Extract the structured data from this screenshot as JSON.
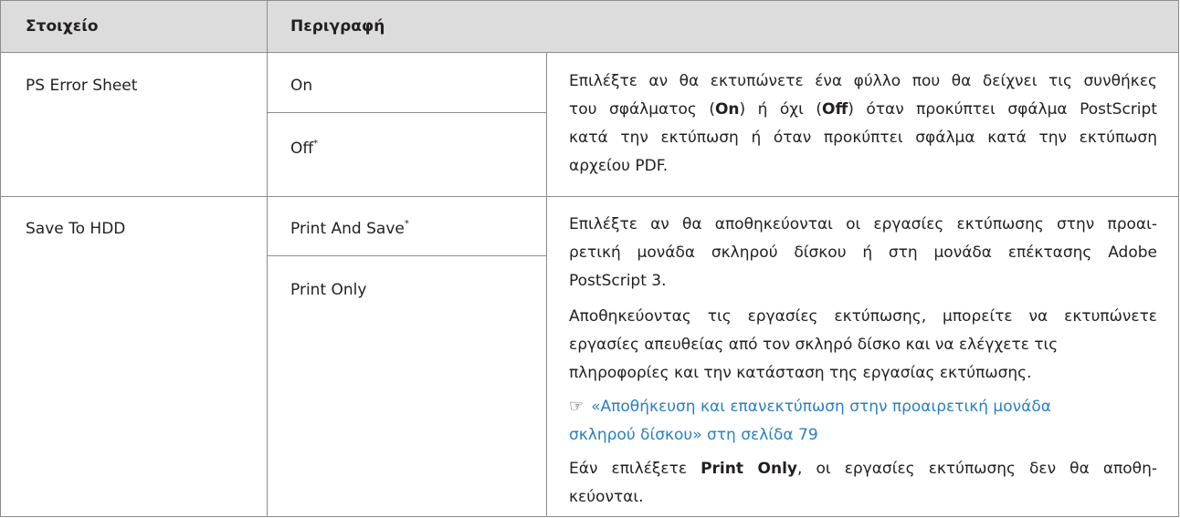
{
  "table": {
    "headers": {
      "item": "Στοιχείο",
      "description": "Περιγραφή"
    },
    "rows": [
      {
        "item": "PS Error Sheet",
        "options": [
          {
            "label": "On",
            "marker": ""
          },
          {
            "label": "Off",
            "marker": "*"
          }
        ],
        "description": {
          "lines": [
            {
              "a": "Επιλέξτε αν θα εκτυπώνετε ένα φύλλο που θα δείχνει τις συνθήκες"
            },
            {
              "a": "του σφάλματος (",
              "b": "On",
              "c": ") ή όχι (",
              "d": "Off",
              "e": ") όταν προκύπτει σφάλμα PostScript"
            },
            {
              "a": "κατά την εκτύπωση ή όταν προκύπτει σφάλμα κατά την εκτύπωση"
            },
            {
              "a": "αρχείου PDF."
            }
          ]
        }
      },
      {
        "item": "Save To HDD",
        "options": [
          {
            "label": "Print And Save",
            "marker": "*"
          },
          {
            "label": "Print Only",
            "marker": ""
          }
        ],
        "description": {
          "p1": [
            "Επιλέξτε αν θα αποθηκεύονται οι εργασίες εκτύπωσης στην προαι-",
            "ρετική μονάδα σκληρού δίσκου ή στη μονάδα επέκτασης Adobe",
            "PostScript 3."
          ],
          "p2": [
            "Αποθηκεύοντας τις εργασίες εκτύπωσης, μπορείτε να εκτυπώνετε",
            "εργασίες απευθείας από τον σκληρό δίσκο και να ελέγχετε τις",
            "πληροφορίες και την κατάσταση της εργασίας εκτύπωσης."
          ],
          "link": {
            "icon": "reference-hand-icon",
            "glyph": "☞",
            "line1": "«Αποθήκευση και επανεκτύπωση στην προαιρετική μονάδα",
            "line2": "σκληρού δίσκου» στη σελίδα 79"
          },
          "p3": {
            "a": "Εάν επιλέξετε ",
            "b": "Print Only",
            "c": ", οι εργασίες εκτύπωσης δεν θα αποθη-",
            "d": "κεύονται."
          }
        }
      }
    ]
  },
  "colors": {
    "header_bg": "#dcdcdc",
    "border": "#8c8c8c",
    "link": "#2a7fc4",
    "text": "#231f20"
  }
}
